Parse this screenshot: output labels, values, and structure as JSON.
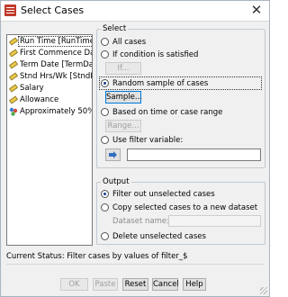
{
  "window": {
    "title": "Select Cases",
    "icon": "spss-dialog-icon",
    "close_label": "✕"
  },
  "variables": [
    {
      "name": "Run Time [RunTime]",
      "icon": "scale-ruler-icon",
      "selected": true
    },
    {
      "name": "First Commence Da...",
      "icon": "scale-ruler-icon"
    },
    {
      "name": "Term Date [TermDa...",
      "icon": "scale-ruler-icon"
    },
    {
      "name": "Stnd Hrs/Wk [StndH...",
      "icon": "scale-ruler-icon"
    },
    {
      "name": "Salary",
      "icon": "scale-ruler-icon"
    },
    {
      "name": "Allowance",
      "icon": "scale-ruler-icon"
    },
    {
      "name": "Approximately 50% ...",
      "icon": "nominal-balls-icon"
    }
  ],
  "select_group": {
    "label": "Select",
    "options": {
      "all_cases": "All cases",
      "if_condition": "If condition is satisfied",
      "random_sample": "Random sample of cases",
      "time_range": "Based on time or case range",
      "filter_variable": "Use filter variable:"
    },
    "selected": "random_sample",
    "buttons": {
      "if": "If...",
      "sample": "Sample...",
      "range": "Range..."
    },
    "arrow_icon": "move-right-arrow-icon",
    "filter_value": ""
  },
  "output_group": {
    "label": "Output",
    "options": {
      "filter_out": "Filter out unselected cases",
      "copy_to_dataset": "Copy selected cases to a new dataset",
      "delete": "Delete unselected cases"
    },
    "selected": "filter_out",
    "dataset_name_label": "Dataset name:",
    "dataset_name_value": ""
  },
  "status": "Current Status: Filter cases by values of filter_$",
  "buttons": {
    "ok": "OK",
    "paste": "Paste",
    "reset": "Reset",
    "cancel": "Cancel",
    "help": "Help"
  },
  "colors": {
    "accent": "#0078d7",
    "radio_dot": "#1a3d8c"
  }
}
